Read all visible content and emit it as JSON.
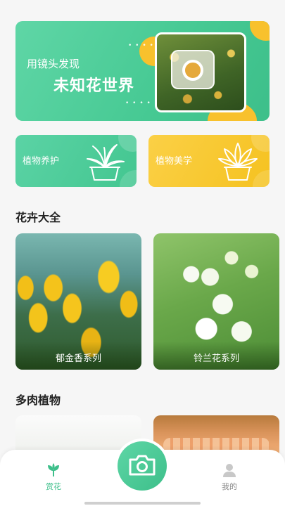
{
  "banner": {
    "line1": "用镜头发现",
    "line2": "未知花世界",
    "dots": "• • • • • • • •"
  },
  "categories": [
    {
      "label": "植物养护",
      "icon": "potted-plant-icon",
      "color": "#4ccb96"
    },
    {
      "label": "植物美学",
      "icon": "succulent-pot-icon",
      "color": "#f8c82b"
    }
  ],
  "sections": {
    "flowers_title": "花卉大全",
    "succulents_title": "多肉植物"
  },
  "flowers": [
    {
      "caption": "郁金香系列"
    },
    {
      "caption": "铃兰花系列"
    }
  ],
  "tabbar": {
    "home_label": "赏花",
    "me_label": "我的",
    "camera_icon": "camera-icon",
    "accent": "#3dbf8a"
  }
}
